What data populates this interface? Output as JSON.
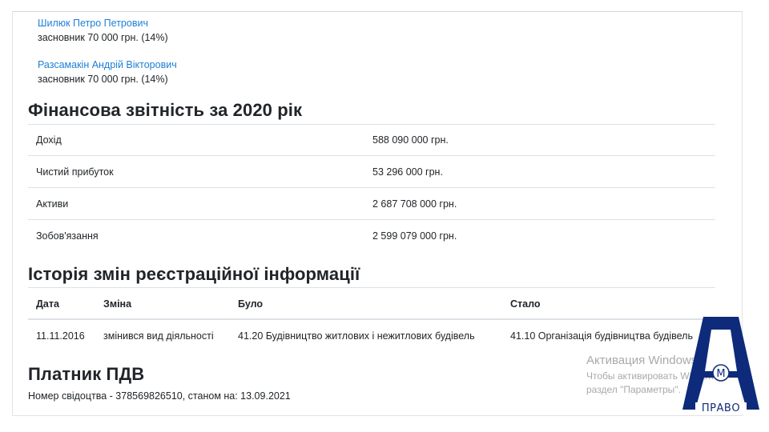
{
  "founders": [
    {
      "name": "Шилюк Петро Петрович",
      "share": "засновник 70 000 грн. (14%)"
    },
    {
      "name": "Разсамакін Андрій Вікторович",
      "share": "засновник 70 000 грн. (14%)"
    }
  ],
  "financial": {
    "title": "Фінансова звітність за 2020 рік",
    "rows": [
      {
        "label": "Дохід",
        "value": "588 090 000 грн."
      },
      {
        "label": "Чистий прибуток",
        "value": "53 296 000 грн."
      },
      {
        "label": "Активи",
        "value": "2 687 708 000 грн."
      },
      {
        "label": "Зобов'язання",
        "value": "2 599 079 000 грн."
      }
    ]
  },
  "history": {
    "title": "Історія змін реєстраційної інформації",
    "headers": {
      "date": "Дата",
      "change": "Зміна",
      "was": "Було",
      "became": "Стало"
    },
    "rows": [
      {
        "date": "11.11.2016",
        "change": "змінився вид діяльності",
        "was": "41.20 Будівництво житлових і нежитлових будівель",
        "became": "41.10 Організація будівництва будівель"
      }
    ]
  },
  "vat": {
    "title": "Платник ПДВ",
    "certificate": "Номер свідоцтва - 378569826510, станом на: 13.09.2021"
  },
  "watermark": {
    "title": "Активация Windows",
    "line1": "Чтобы активировать Windows,",
    "line2": "раздел \"Параметры\"."
  },
  "logo": {
    "text": "ПРАВО",
    "mark": "M",
    "color": "#0e2a7a"
  }
}
